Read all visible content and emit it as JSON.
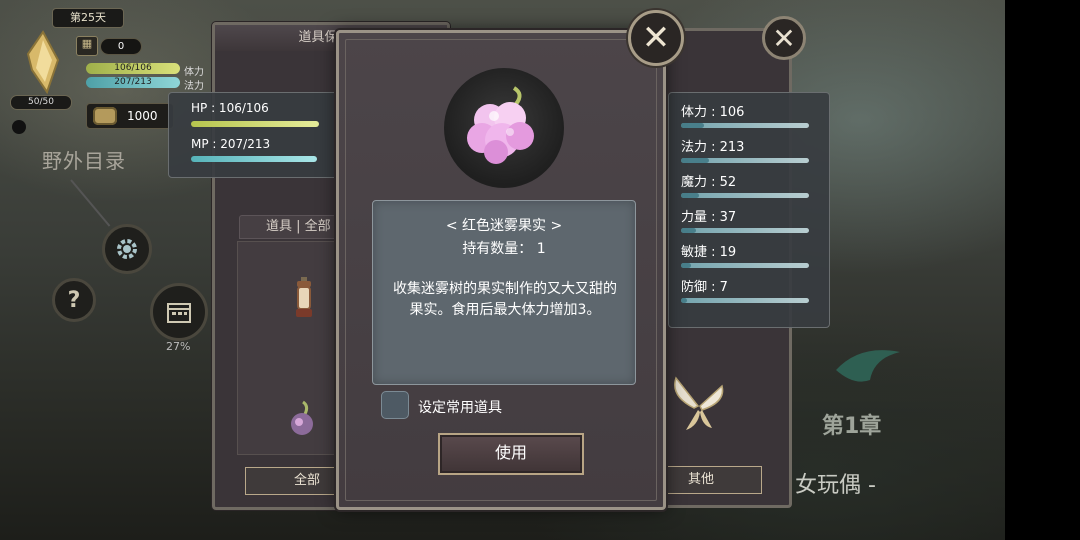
{
  "hud": {
    "day": "第25天",
    "bag_count": "0",
    "hp_mini": "106/106",
    "mp_mini": "207/213",
    "hp_label": "体力",
    "mp_label": "法力",
    "level": "50/50",
    "gold": "1000",
    "area_title": "野外目录",
    "progress_pct": "27%",
    "help_glyph": "?"
  },
  "inventory": {
    "title": "道具保管箱",
    "hp_text": "HP : 106/106",
    "mp_text": "MP : 207/213",
    "tab_header": "道具 | 全部",
    "tab_all": "全部",
    "tab_other": "其他"
  },
  "stats": {
    "vitality": "体力 : 106",
    "mana": "法力 : 213",
    "magic": "魔力 : 52",
    "strength": "力量 : 37",
    "agility": "敏捷 : 19",
    "defense": "防御 : 7"
  },
  "dialog": {
    "item_name": "< 红色迷雾果实 >",
    "quantity": "持有数量：  1",
    "description": "收集迷雾树的果实制作的又大又甜的果实。食用后最大体力增加3。",
    "set_common_label": "设定常用道具",
    "use_button": "使用",
    "close_glyph": "✕"
  },
  "chapter": {
    "label": "第1章",
    "subtitle": "女玩偶 -"
  },
  "colors": {
    "panel": "#3a3438",
    "desc_box": "#5e676e",
    "hp_bar": "#d9e07a",
    "mp_bar": "#8fd6d8",
    "border_gold": "#b8a585"
  }
}
